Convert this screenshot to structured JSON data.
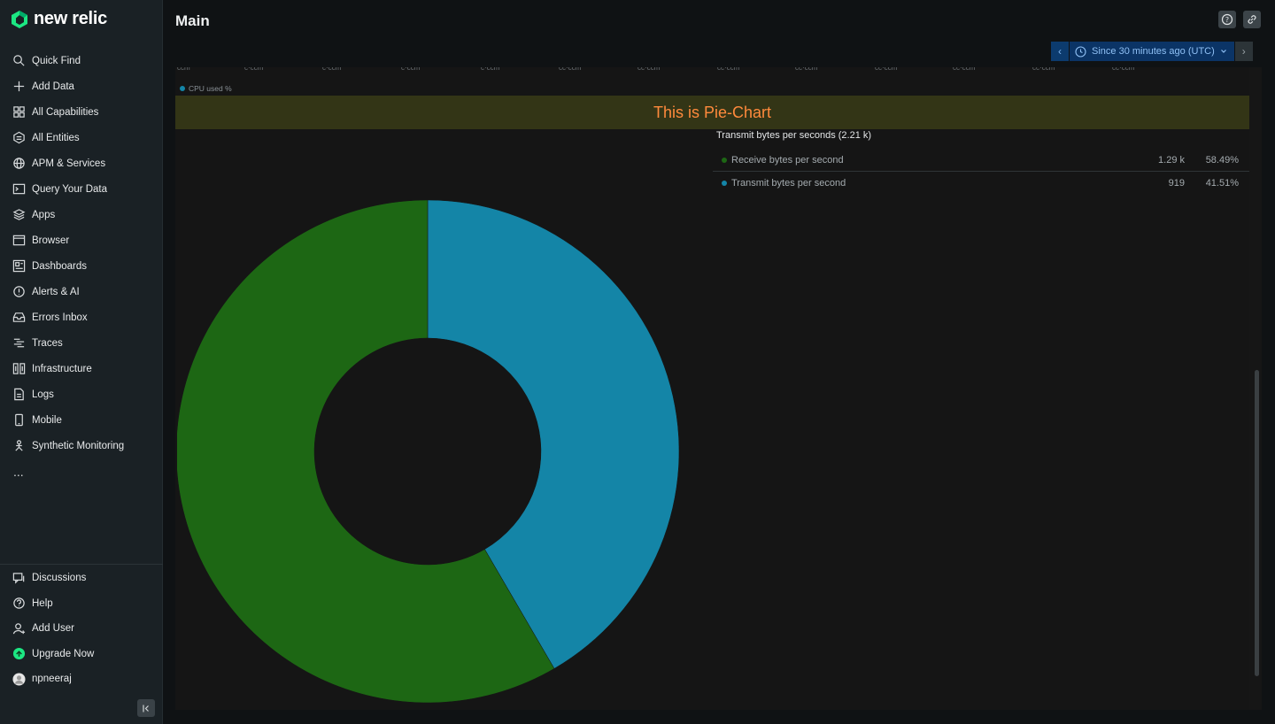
{
  "app": {
    "brand": "new relic"
  },
  "sidebar": {
    "items": [
      {
        "label": "Quick Find",
        "icon": "search-icon"
      },
      {
        "label": "Add Data",
        "icon": "plus-icon"
      },
      {
        "label": "All Capabilities",
        "icon": "grid-icon"
      },
      {
        "label": "All Entities",
        "icon": "hexagon-icon"
      },
      {
        "label": "APM & Services",
        "icon": "globe-icon"
      },
      {
        "label": "Query Your Data",
        "icon": "terminal-icon"
      },
      {
        "label": "Apps",
        "icon": "layers-icon"
      },
      {
        "label": "Browser",
        "icon": "browser-icon"
      },
      {
        "label": "Dashboards",
        "icon": "dashboard-icon"
      },
      {
        "label": "Alerts & AI",
        "icon": "alert-icon"
      },
      {
        "label": "Errors Inbox",
        "icon": "inbox-icon"
      },
      {
        "label": "Traces",
        "icon": "traces-icon"
      },
      {
        "label": "Infrastructure",
        "icon": "infrastructure-icon"
      },
      {
        "label": "Logs",
        "icon": "logs-icon"
      },
      {
        "label": "Mobile",
        "icon": "mobile-icon"
      },
      {
        "label": "Synthetic Monitoring",
        "icon": "synthetic-icon"
      }
    ],
    "more": "...",
    "bottom": [
      {
        "label": "Discussions",
        "icon": "discussions-icon"
      },
      {
        "label": "Help",
        "icon": "help-icon"
      },
      {
        "label": "Add User",
        "icon": "add-user-icon"
      },
      {
        "label": "Upgrade Now",
        "icon": "upgrade-icon"
      },
      {
        "label": "npneeraj",
        "icon": "avatar-icon"
      }
    ]
  },
  "header": {
    "title": "Main",
    "time_picker": "Since 30 minutes ago (UTC)"
  },
  "widget": {
    "legend_label": "CPU used %",
    "banner": "This is Pie-Chart",
    "table_title": "Transmit bytes per seconds (2.21 k)"
  },
  "colors": {
    "receive": "#1d6714",
    "transmit": "#1485a7",
    "cpu": "#1485a7",
    "banner_text": "#ff8a3c"
  },
  "chart_data": {
    "type": "pie",
    "donut": true,
    "title": "Transmit bytes per seconds (2.21 k)",
    "total": "2.21 k",
    "slices": [
      {
        "name": "Receive bytes per second",
        "value_label": "1.29 k",
        "value": 1290,
        "percent_label": "58.49%",
        "percent": 58.49,
        "color": "#1d6714"
      },
      {
        "name": "Transmit bytes per second",
        "value_label": "919",
        "value": 919,
        "percent_label": "41.51%",
        "percent": 41.51,
        "color": "#1485a7"
      }
    ]
  }
}
